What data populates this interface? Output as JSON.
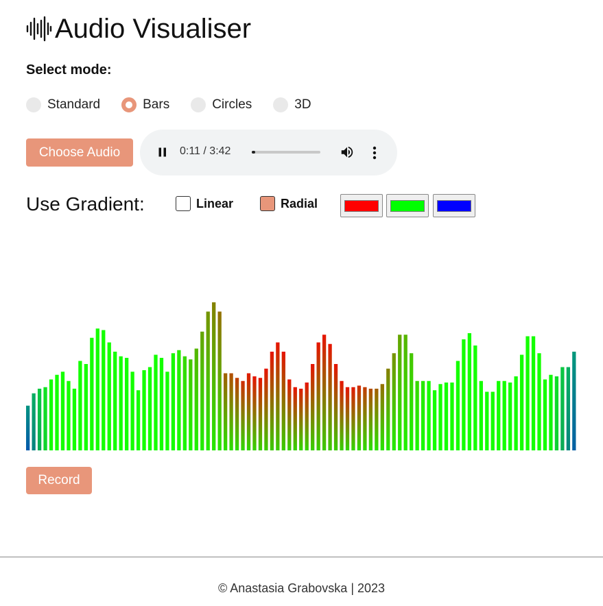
{
  "app": {
    "title": "Audio Visualiser",
    "icon": "waveform-icon"
  },
  "mode": {
    "label": "Select mode:",
    "options": [
      "Standard",
      "Bars",
      "Circles",
      "3D"
    ],
    "selected": "Bars"
  },
  "controls": {
    "choose_audio_label": "Choose Audio",
    "record_label": "Record"
  },
  "player": {
    "time_display": "0:11 / 3:42",
    "progress": 0.05,
    "state": "playing"
  },
  "gradient": {
    "label": "Use Gradient:",
    "linear_label": "Linear",
    "linear_checked": false,
    "radial_label": "Radial",
    "radial_checked": true,
    "colors": [
      "#ff0000",
      "#00ff00",
      "#0000ff"
    ]
  },
  "visualizer": {
    "levels": [
      0.29,
      0.37,
      0.4,
      0.41,
      0.46,
      0.49,
      0.51,
      0.45,
      0.4,
      0.58,
      0.56,
      0.73,
      0.79,
      0.78,
      0.7,
      0.64,
      0.61,
      0.6,
      0.51,
      0.39,
      0.52,
      0.54,
      0.62,
      0.6,
      0.51,
      0.63,
      0.65,
      0.61,
      0.59,
      0.66,
      0.77,
      0.9,
      0.96,
      0.9,
      0.5,
      0.5,
      0.47,
      0.45,
      0.5,
      0.48,
      0.47,
      0.53,
      0.64,
      0.7,
      0.64,
      0.46,
      0.41,
      0.4,
      0.44,
      0.56,
      0.7,
      0.75,
      0.69,
      0.56,
      0.45,
      0.41,
      0.41,
      0.42,
      0.41,
      0.4,
      0.4,
      0.43,
      0.53,
      0.63,
      0.75,
      0.75,
      0.63,
      0.45,
      0.45,
      0.45,
      0.39,
      0.43,
      0.44,
      0.44,
      0.58,
      0.72,
      0.76,
      0.68,
      0.45,
      0.38,
      0.38,
      0.45,
      0.45,
      0.44,
      0.48,
      0.62,
      0.74,
      0.74,
      0.63,
      0.46,
      0.49,
      0.48,
      0.54,
      0.54,
      0.64
    ]
  },
  "footer": {
    "text": "© Anastasia Grabovska | 2023"
  }
}
